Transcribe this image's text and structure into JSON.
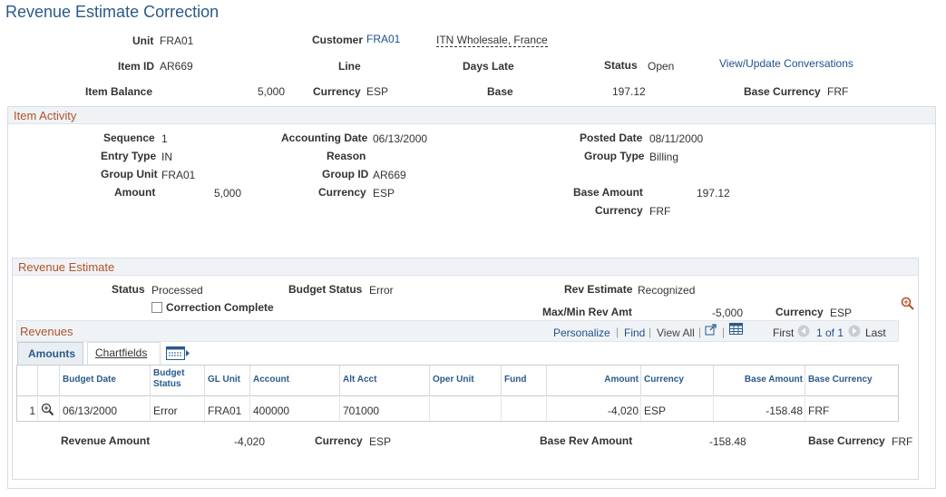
{
  "page": {
    "title": "Revenue Estimate Correction"
  },
  "header": {
    "unit_label": "Unit",
    "unit": "FRA01",
    "customer_label": "Customer",
    "customer_id": "FRA01",
    "customer_name": "ITN Wholesale, France",
    "item_id_label": "Item ID",
    "item_id": "AR669",
    "line_label": "Line",
    "days_late_label": "Days Late",
    "status_label": "Status",
    "status": "Open",
    "conversations_link": "View/Update Conversations",
    "item_balance_label": "Item Balance",
    "item_balance": "5,000",
    "currency_label": "Currency",
    "currency": "ESP",
    "base_label": "Base",
    "base": "197.12",
    "base_currency_label": "Base Currency",
    "base_currency": "FRF"
  },
  "item_activity": {
    "title": "Item Activity",
    "sequence_label": "Sequence",
    "sequence": "1",
    "entry_type_label": "Entry Type",
    "entry_type": "IN",
    "group_unit_label": "Group Unit",
    "group_unit": "FRA01",
    "amount_label": "Amount",
    "amount": "5,000",
    "accounting_date_label": "Accounting Date",
    "accounting_date": "06/13/2000",
    "reason_label": "Reason",
    "group_id_label": "Group ID",
    "group_id": "AR669",
    "currency_label": "Currency",
    "currency": "ESP",
    "posted_date_label": "Posted Date",
    "posted_date": "08/11/2000",
    "group_type_label": "Group Type",
    "group_type": "Billing",
    "base_amount_label": "Base Amount",
    "base_amount": "197.12",
    "base_currency_label": "Currency",
    "base_currency": "FRF"
  },
  "revenue_estimate": {
    "title": "Revenue Estimate",
    "status_label": "Status",
    "status": "Processed",
    "budget_status_label": "Budget Status",
    "budget_status": "Error",
    "rev_estimate_label": "Rev Estimate",
    "rev_estimate": "Recognized",
    "correction_complete_label": "Correction Complete",
    "correction_complete_checked": false,
    "max_min_label": "Max/Min Rev Amt",
    "max_min": "-5,000",
    "currency_label": "Currency",
    "currency": "ESP",
    "revenue_amount_label": "Revenue Amount",
    "revenue_amount": "-4,020",
    "bottom_currency_label": "Currency",
    "bottom_currency": "ESP",
    "base_rev_amount_label": "Base Rev Amount",
    "base_rev_amount": "-158.48",
    "bottom_base_currency_label": "Base Currency",
    "bottom_base_currency": "FRF"
  },
  "revenues": {
    "title": "Revenues",
    "personalize": "Personalize",
    "find": "Find",
    "view_all": "View All",
    "first": "First",
    "counter": "1 of 1",
    "last": "Last",
    "tabs": [
      "Amounts",
      "Chartfields"
    ],
    "columns": [
      "Budget Date",
      "Budget Status",
      "GL Unit",
      "Account",
      "Alt Acct",
      "Oper Unit",
      "Fund",
      "Amount",
      "Currency",
      "Base Amount",
      "Base Currency"
    ],
    "rows": [
      {
        "num": "1",
        "budget_date": "06/13/2000",
        "budget_status": "Error",
        "gl_unit": "FRA01",
        "account": "400000",
        "alt_acct": "701000",
        "oper_unit": "",
        "fund": "",
        "amount": "-4,020",
        "currency": "ESP",
        "base_amount": "-158.48",
        "base_currency": "FRF"
      }
    ]
  },
  "icons": [
    "zoom-icon",
    "new-window-icon",
    "grid-icon",
    "prev-arrow-icon",
    "next-arrow-icon",
    "show-all-tabs-icon",
    "row-detail-icon"
  ],
  "colors": {
    "title": "#2a5a8a",
    "link": "#1f4f8c",
    "section_title": "#b0522a",
    "header_bg": "#f0f3f6"
  }
}
